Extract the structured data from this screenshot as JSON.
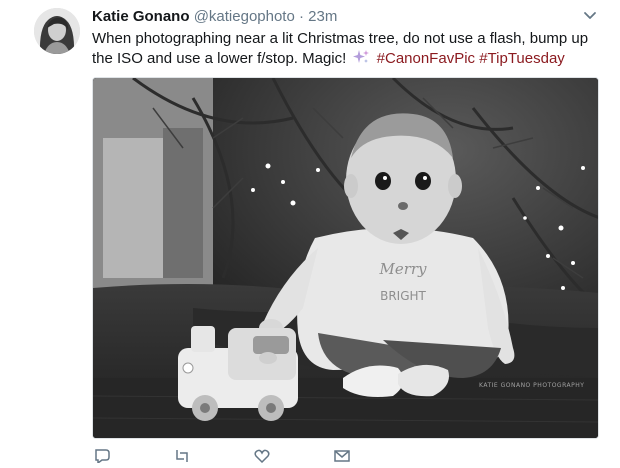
{
  "tweet": {
    "author_name": "Katie Gonano",
    "author_handle": "@katiegophoto",
    "separator": "·",
    "time": "23m",
    "text_main": "When photographing near a lit Christmas tree, do not use a flash, bump up the ISO and use a lower f/stop. Magic!",
    "hashtags": [
      "#CanonFavPic",
      "#TipTuesday"
    ],
    "watermark": "KATIE GONANO PHOTOGRAPHY",
    "shirt_text_1": "Merry",
    "shirt_text_2": "BRIGHT"
  },
  "icons": {
    "caret": "chevron-down-icon",
    "sparkle": "sparkles-emoji",
    "reply": "reply-icon",
    "retweet": "retweet-icon",
    "like": "heart-icon",
    "dm": "envelope-icon"
  },
  "colors": {
    "hashtag": "#8b1a1f",
    "secondary_text": "#657786"
  }
}
